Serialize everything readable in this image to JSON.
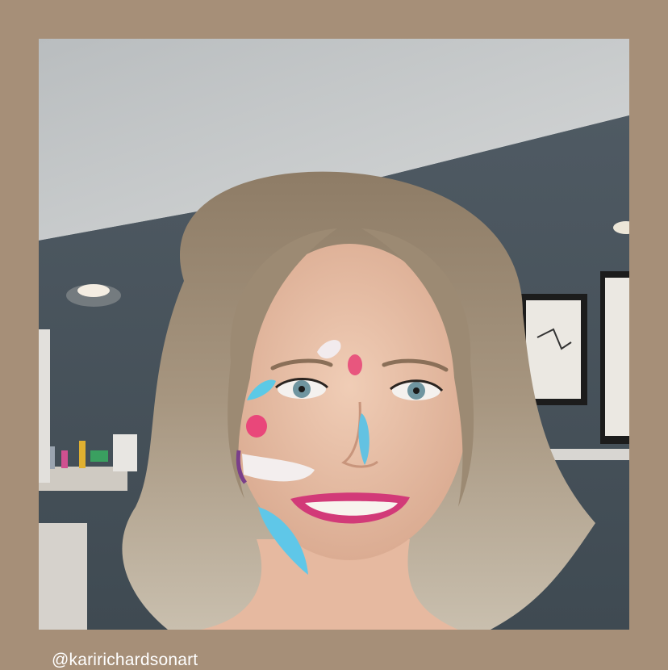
{
  "post": {
    "handle": "@karirichardsonart"
  },
  "photo": {
    "subject": "selfie-portrait-with-face-paint",
    "background_color": "#a68f78"
  }
}
